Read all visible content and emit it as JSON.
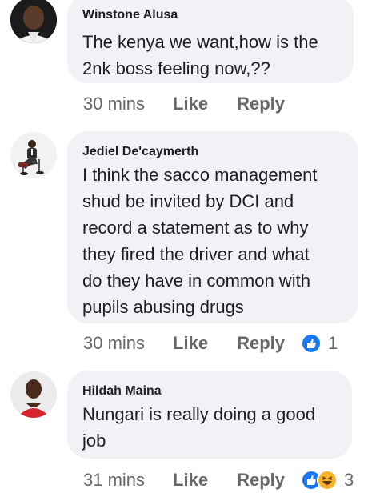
{
  "comments": [
    {
      "author": "Winstone Alusa",
      "lines": [
        "The kenya we want,how is the",
        "2nk boss feeling now,??"
      ],
      "time": "30 mins",
      "like_label": "Like",
      "reply_label": "Reply"
    },
    {
      "author": "Jediel De'caymerth",
      "lines": [
        "I think the sacco management",
        "shud be invited by DCI and",
        "record a statement as to why",
        "they fired the driver and what",
        "do they have in common with",
        "pupils abusing drugs"
      ],
      "time": "30 mins",
      "like_label": "Like",
      "reply_label": "Reply",
      "reactions": {
        "icons": [
          "like-icon"
        ],
        "count": "1"
      }
    },
    {
      "author": "Hildah Maina",
      "lines": [
        "Nungari is really doing a good",
        "job"
      ],
      "time": "31 mins",
      "like_label": "Like",
      "reply_label": "Reply",
      "reactions": {
        "icons": [
          "like-icon",
          "haha-icon"
        ],
        "count": "3"
      }
    }
  ],
  "colors": {
    "bubble": "#f0f2f5",
    "text": "#1c1e21",
    "meta": "#65676b",
    "like_blue": "#1877f2",
    "haha_yellow": "#f7b125"
  }
}
